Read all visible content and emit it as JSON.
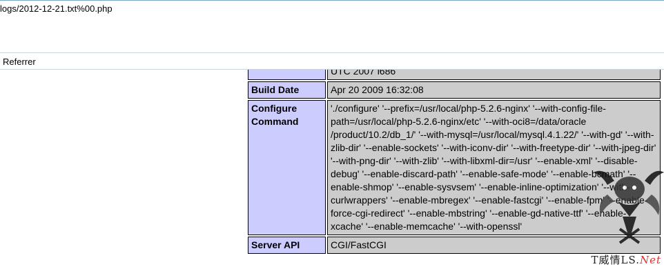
{
  "address_bar": {
    "url_text": "logs/2012-12-21.txt%00.php"
  },
  "links_bar": {
    "referrer_label": "Referrer"
  },
  "phpinfo": {
    "rows": [
      {
        "label": "",
        "value": "UTC 2007 i686"
      },
      {
        "label": "Build Date",
        "value": "Apr 20 2009 16:32:08"
      },
      {
        "label": "Configure Command",
        "value": "'./configure' '--prefix=/usr/local/php-5.2.6-nginx' '--with-config-file-path=/usr/local/php-5.2.6-nginx/etc' '--with-oci8=/data/oracle /product/10.2/db_1/' '--with-mysql=/usr/local/mysql.4.1.22/' '--with-gd' '--with-zlib-dir' '--enable-sockets' '--with-iconv-dir' '--with-freetype-dir' '--with-jpeg-dir' '--with-png-dir' '--with-zlib' '--with-libxml-dir=/usr' '--enable-xml' '--disable-debug' '--enable-discard-path' '--enable-safe-mode' '--enable-bcmath' '--enable-shmop' '--enable-sysvsem' '--enable-inline-optimization' '--with-curlwrappers' '--enable-mbregex' '--enable-fastcgi' '--enable-fpm' '--enable-force-cgi-redirect' '--enable-mbstring' '--enable-gd-native-ttf' '--enable-xcache' '--enable-memcache' '--with-openssl'"
      },
      {
        "label": "Server API",
        "value": "CGI/FastCGI"
      }
    ]
  },
  "watermark": {
    "text_main": "T威情LS.",
    "text_net": "Net"
  }
}
